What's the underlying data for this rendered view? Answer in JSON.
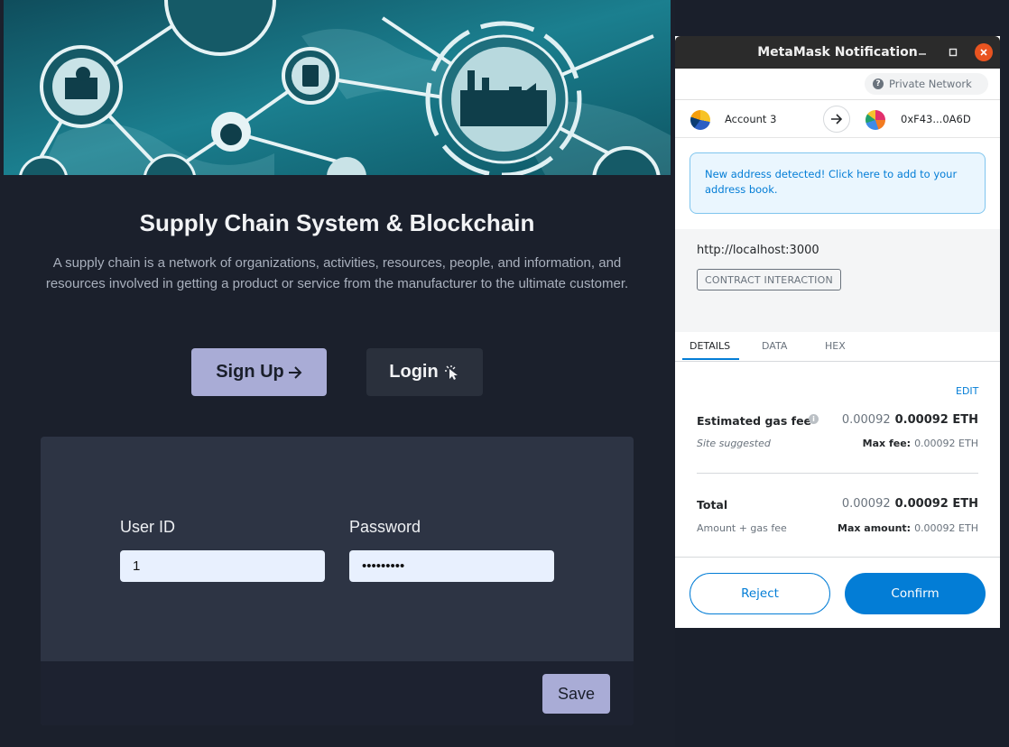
{
  "app": {
    "headline": "Supply Chain System & Blockchain",
    "description": "A supply chain is a network of organizations, activities, resources, people, and information, and resources involved in getting a product or service from the manufacturer to the ultimate customer.",
    "signup_label": "Sign Up",
    "login_label": "Login",
    "form": {
      "userid_label": "User ID",
      "userid_value": "1",
      "password_label": "Password",
      "password_value": "•••••••••",
      "save_label": "Save"
    }
  },
  "metamask": {
    "window_title": "MetaMask Notification",
    "network": "Private Network",
    "from_account": "Account 3",
    "to_address": "0xF43...0A6D",
    "notice": "New address detected! Click here to add to your address book.",
    "origin": "http://localhost:3000",
    "interaction_type": "CONTRACT INTERACTION",
    "tabs": [
      {
        "label": "DETAILS",
        "active": true
      },
      {
        "label": "DATA",
        "active": false
      },
      {
        "label": "HEX",
        "active": false
      }
    ],
    "edit_label": "EDIT",
    "gas": {
      "label": "Estimated gas fee",
      "secondary": "0.00092",
      "primary": "0.00092 ETH",
      "subtext": "Site suggested",
      "max_label": "Max fee:",
      "max_value": "0.00092 ETH"
    },
    "total": {
      "label": "Total",
      "secondary": "0.00092",
      "primary": "0.00092 ETH",
      "subtext": "Amount + gas fee",
      "max_label": "Max amount:",
      "max_value": "0.00092 ETH"
    },
    "reject_label": "Reject",
    "confirm_label": "Confirm"
  },
  "colors": {
    "page_bg": "#1b202c",
    "card_bg": "#2d3444",
    "accent_button": "#a9acd6",
    "metamask_blue": "#037dd6",
    "ubuntu_close": "#e95420"
  },
  "icons": [
    "arrow-right-icon",
    "pointer-click-icon",
    "minimize-icon",
    "maximize-icon",
    "close-icon",
    "question-icon",
    "info-icon",
    "map-pin-icon",
    "clipboard-icon",
    "stopwatch-icon",
    "factory-icon"
  ]
}
